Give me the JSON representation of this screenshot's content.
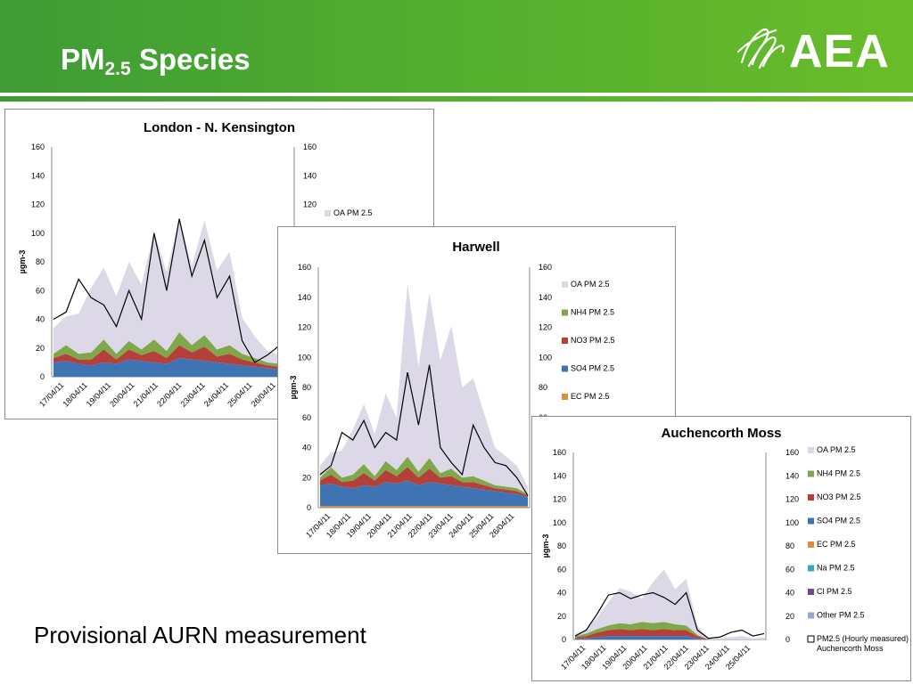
{
  "page": {
    "title_main": "PM",
    "title_sub": "2.5",
    "title_rest": " Species",
    "logo_text": "AEA",
    "caption": "Provisional AURN measurement"
  },
  "colors": {
    "header_green_left": "#3e9b35",
    "header_green_right": "#6ebf2b",
    "OA": "#ddd8e8",
    "NH4": "#7fa84a",
    "NO3": "#b5403a",
    "SO4": "#3f74b4",
    "EC": "#e08b3b",
    "Na": "#3aa7bd",
    "Cl": "#6d4c8e",
    "Other": "#93a8cc",
    "line": "#000000"
  },
  "chart_data": [
    {
      "id": "london",
      "type": "area",
      "title": "London  - N. Kensington",
      "ylabel": "µgm-3",
      "ylim": [
        0,
        160
      ],
      "yticks": [
        0,
        20,
        40,
        60,
        80,
        100,
        120,
        140,
        160
      ],
      "categories": [
        "17/04/11",
        "18/04/11",
        "19/04/11",
        "20/04/11",
        "21/04/11",
        "22/04/11",
        "23/04/11",
        "24/04/11",
        "25/04/11",
        "26/04/11"
      ],
      "legend": [
        {
          "name": "OA PM 2.5",
          "color": "#ddd8e8"
        }
      ],
      "series": [
        {
          "name": "SO4 PM 2.5",
          "color": "#3f74b4",
          "values": [
            10,
            11,
            9,
            8,
            10,
            9,
            12,
            11,
            10,
            9,
            13,
            12,
            11,
            10,
            9,
            8,
            7,
            6,
            5,
            4
          ]
        },
        {
          "name": "NO3 PM 2.5",
          "color": "#b5403a",
          "values": [
            3,
            5,
            3,
            4,
            9,
            3,
            7,
            4,
            8,
            4,
            9,
            5,
            10,
            4,
            7,
            4,
            3,
            2,
            2,
            2
          ]
        },
        {
          "name": "NH4 PM 2.5",
          "color": "#7fa84a",
          "values": [
            3,
            6,
            4,
            5,
            7,
            4,
            6,
            4,
            8,
            5,
            9,
            5,
            8,
            5,
            6,
            4,
            3,
            2,
            2,
            2
          ]
        },
        {
          "name": "OA PM 2.5",
          "color": "#ddd8e8",
          "values": [
            18,
            20,
            28,
            45,
            50,
            40,
            55,
            45,
            75,
            55,
            80,
            55,
            80,
            55,
            65,
            25,
            15,
            8,
            6,
            4
          ]
        }
      ],
      "line": {
        "name": "PM2.5",
        "values": [
          40,
          45,
          68,
          55,
          50,
          35,
          60,
          40,
          100,
          60,
          110,
          70,
          95,
          55,
          70,
          25,
          10,
          15,
          22,
          8
        ]
      }
    },
    {
      "id": "harwell",
      "type": "area",
      "title": "Harwell",
      "ylabel": "µgm-3",
      "ylim": [
        0,
        160
      ],
      "yticks": [
        0,
        20,
        40,
        60,
        80,
        100,
        120,
        140,
        160
      ],
      "categories": [
        "17/04/11",
        "18/04/11",
        "19/04/11",
        "20/04/11",
        "21/04/11",
        "22/04/11",
        "23/04/11",
        "24/04/11",
        "25/04/11",
        "26/04/11"
      ],
      "legend": [
        {
          "name": "OA PM 2.5",
          "color": "#ddd8e8"
        },
        {
          "name": "NH4 PM 2.5",
          "color": "#7fa84a"
        },
        {
          "name": "NO3 PM 2.5",
          "color": "#b5403a"
        },
        {
          "name": "SO4 PM 2.5",
          "color": "#3f74b4"
        },
        {
          "name": "EC PM 2.5",
          "color": "#e08b3b"
        }
      ],
      "series": [
        {
          "name": "EC PM 2.5",
          "color": "#e08b3b",
          "values": [
            1,
            1,
            1,
            1,
            1,
            1,
            1,
            1,
            1,
            1,
            1,
            1,
            1,
            1,
            1,
            1,
            1,
            1,
            1,
            1
          ]
        },
        {
          "name": "SO4 PM 2.5",
          "color": "#3f74b4",
          "values": [
            14,
            15,
            13,
            12,
            14,
            13,
            16,
            15,
            17,
            14,
            16,
            15,
            14,
            13,
            12,
            11,
            10,
            9,
            8,
            6
          ]
        },
        {
          "name": "NO3 PM 2.5",
          "color": "#b5403a",
          "values": [
            3,
            6,
            3,
            5,
            8,
            4,
            8,
            5,
            9,
            5,
            9,
            4,
            6,
            3,
            4,
            3,
            2,
            2,
            2,
            1
          ]
        },
        {
          "name": "NH4 PM 2.5",
          "color": "#7fa84a",
          "values": [
            2,
            5,
            3,
            4,
            6,
            3,
            6,
            4,
            7,
            4,
            7,
            3,
            5,
            3,
            4,
            3,
            2,
            2,
            2,
            1
          ]
        },
        {
          "name": "OA PM 2.5",
          "color": "#ddd8e8",
          "values": [
            8,
            10,
            18,
            30,
            40,
            28,
            45,
            35,
            115,
            70,
            110,
            75,
            95,
            60,
            65,
            45,
            25,
            20,
            15,
            5
          ]
        }
      ],
      "line": {
        "name": "PM2.5",
        "values": [
          22,
          28,
          50,
          45,
          58,
          40,
          50,
          45,
          90,
          55,
          95,
          40,
          30,
          22,
          55,
          40,
          30,
          28,
          20,
          8
        ]
      }
    },
    {
      "id": "auchencorth",
      "type": "area",
      "title": "Auchencorth Moss",
      "ylabel": "µgm-3",
      "ylim": [
        0,
        160
      ],
      "yticks": [
        0,
        20,
        40,
        60,
        80,
        100,
        120,
        140,
        160
      ],
      "categories": [
        "17/04/11",
        "18/04/11",
        "19/04/11",
        "20/04/11",
        "21/04/11",
        "22/04/11",
        "23/04/11",
        "24/04/11",
        "25/04/11"
      ],
      "legend": [
        {
          "name": "OA PM 2.5",
          "color": "#ddd8e8"
        },
        {
          "name": "NH4 PM 2.5",
          "color": "#7fa84a"
        },
        {
          "name": "NO3 PM 2.5",
          "color": "#b5403a"
        },
        {
          "name": "SO4 PM 2.5",
          "color": "#3f74b4"
        },
        {
          "name": "EC PM 2.5",
          "color": "#e08b3b"
        },
        {
          "name": "Na PM 2.5",
          "color": "#3aa7bd"
        },
        {
          "name": "Cl PM 2.5",
          "color": "#6d4c8e"
        },
        {
          "name": "Other PM 2.5",
          "color": "#93a8cc"
        },
        {
          "name": "PM2.5 (Hourly measured) Auchencorth Moss",
          "color": "#ffffff",
          "outline": true
        }
      ],
      "series": [
        {
          "name": "SO4 PM 2.5",
          "color": "#3f74b4",
          "values": [
            1,
            1,
            2,
            3,
            3,
            3,
            3,
            3,
            3,
            3,
            3,
            1,
            0,
            0,
            0,
            0,
            0,
            0
          ]
        },
        {
          "name": "NO3 PM 2.5",
          "color": "#b5403a",
          "values": [
            1,
            2,
            4,
            5,
            6,
            5,
            6,
            5,
            6,
            5,
            5,
            2,
            0,
            0,
            0,
            0,
            0,
            0
          ]
        },
        {
          "name": "NH4 PM 2.5",
          "color": "#7fa84a",
          "values": [
            1,
            2,
            3,
            4,
            5,
            5,
            6,
            6,
            6,
            5,
            4,
            1,
            0,
            0,
            0,
            0,
            0,
            0
          ]
        },
        {
          "name": "OA PM 2.5",
          "color": "#ddd8e8",
          "values": [
            2,
            4,
            10,
            20,
            30,
            28,
            20,
            35,
            45,
            30,
            40,
            8,
            0,
            1,
            2,
            3,
            1,
            2
          ]
        }
      ],
      "line": {
        "name": "PM2.5 (Hourly measured) Auchencorth Moss",
        "values": [
          3,
          8,
          22,
          38,
          40,
          35,
          38,
          40,
          36,
          30,
          40,
          8,
          1,
          2,
          6,
          8,
          3,
          5
        ]
      }
    }
  ]
}
